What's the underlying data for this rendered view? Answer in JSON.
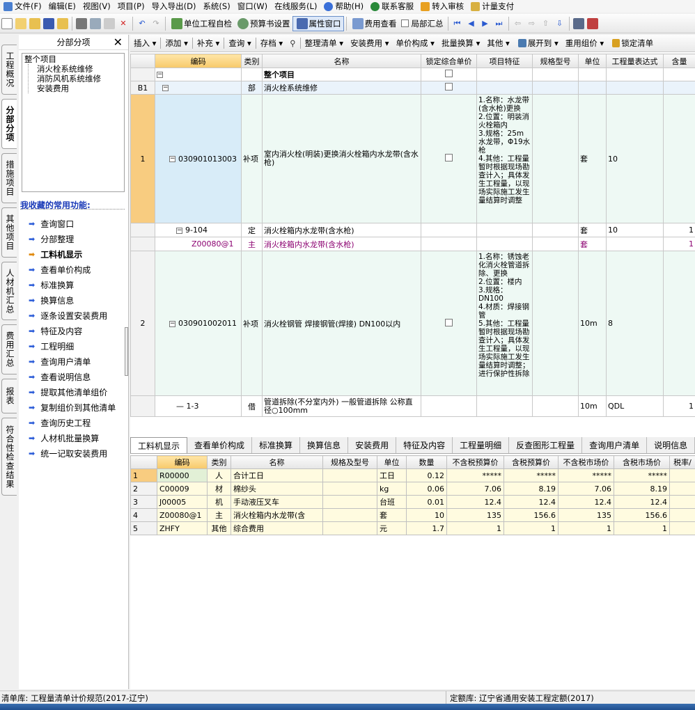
{
  "menu": [
    {
      "label": "文件(F)",
      "icon": "file-menu-icon"
    },
    {
      "label": "编辑(E)"
    },
    {
      "label": "视图(V)"
    },
    {
      "label": "项目(P)"
    },
    {
      "label": "导入导出(D)"
    },
    {
      "label": "系统(S)"
    },
    {
      "label": "窗口(W)"
    },
    {
      "label": "在线服务(L)"
    },
    {
      "label": "帮助(H)",
      "icon": "help-icon"
    },
    {
      "label": "联系客服",
      "icon": "contact-service-icon"
    },
    {
      "label": "转入审核",
      "icon": "audit-icon"
    },
    {
      "label": "计量支付",
      "icon": "payment-icon"
    }
  ],
  "toolbar": {
    "unit_check": "单位工程自检",
    "budget_settings": "预算书设置",
    "property_window": "属性窗口",
    "fee_view": "费用查看",
    "local_summary": "局部汇总"
  },
  "left_tabs": [
    "工程概况",
    "分部分项",
    "措施项目",
    "其他项目",
    "人材机汇总",
    "费用汇总",
    "报表",
    "符合性检查结果"
  ],
  "left_panel": {
    "title": "分部分项",
    "close": "✕",
    "tree": {
      "root": "整个项目",
      "children": [
        "消火栓系统维修",
        "消防风机系统维修",
        "安装费用"
      ]
    },
    "fav_title": "我收藏的常用功能:",
    "favorites": [
      "查询窗口",
      "分部整理",
      "工料机显示",
      "查看单价构成",
      "标准换算",
      "换算信息",
      "逐条设置安装费用",
      "特征及内容",
      "工程明细",
      "查询用户清单",
      "查看说明信息",
      "提取其他清单组价",
      "复制组价到其他清单",
      "查询历史工程",
      "人材机批量换算",
      "统一记取安装费用"
    ]
  },
  "grid_toolbar": [
    "插入",
    "添加",
    "补充",
    "查询",
    "存档",
    "整理清单",
    "安装费用",
    "单价构成",
    "批量换算",
    "其他",
    "展开到",
    "重用组价",
    "锁定清单"
  ],
  "grid": {
    "headers": [
      "编码",
      "类别",
      "名称",
      "锁定综合单价",
      "项目特征",
      "规格型号",
      "单位",
      "工程量表达式",
      "含量"
    ],
    "rows": [
      {
        "idx": "",
        "code": "",
        "type": "",
        "name": "整个项目",
        "feature": "",
        "unit": "",
        "expr": "",
        "qty": ""
      },
      {
        "idx": "B1",
        "code": "",
        "type": "部",
        "name": "消火栓系统维修",
        "feature": "",
        "unit": "",
        "expr": "",
        "qty": ""
      },
      {
        "idx": "1",
        "code": "030901013003",
        "type": "补项",
        "name": "室内消火栓(明装)更换消火栓箱内水龙带(含水枪)",
        "feature": "1.名称：水龙带(含水枪)更换\n2.位置：明装消火栓箱内\n3.规格：25m水龙带，Φ19水枪\n4.其他：工程量暂时根据现场勘查计入；具体发生工程量，以现场实际施工发生量结算时调整",
        "unit": "套",
        "expr": "10",
        "qty": ""
      },
      {
        "idx": "",
        "code": "9-104",
        "type": "定",
        "name": "消火栓箱内水龙带(含水枪)",
        "feature": "",
        "unit": "套",
        "expr": "10",
        "qty": "1"
      },
      {
        "idx": "",
        "code": "Z00080@1",
        "type": "主",
        "name": "消火栓箱内水龙带(含水枪)",
        "feature": "",
        "unit": "套",
        "expr": "",
        "qty": "1"
      },
      {
        "idx": "2",
        "code": "030901002011",
        "type": "补项",
        "name": "消火栓钢管 焊接钢管(焊接) DN100以内",
        "feature": "1.名称：锈蚀老化消火栓管道拆除、更换\n2.位置：楼内\n3.规格：DN100\n4.材质：焊接钢管\n5.其他：工程量暂时根据现场勘查计入；具体发生工程量，以现场实际施工发生量结算时调整；进行保护性拆除",
        "unit": "10m",
        "expr": "8",
        "qty": ""
      },
      {
        "idx": "",
        "code": "1-3",
        "type": "借",
        "name": "管道拆除(不分室内外) 一般管道拆除 公称直径○100mm",
        "feature": "",
        "unit": "10m",
        "expr": "QDL",
        "qty": "1"
      }
    ]
  },
  "bottom_tabs": [
    "工料机显示",
    "查看单价构成",
    "标准换算",
    "换算信息",
    "安装费用",
    "特征及内容",
    "工程量明细",
    "反查图形工程量",
    "查询用户清单",
    "说明信息"
  ],
  "sub": {
    "headers": [
      "编码",
      "类别",
      "名称",
      "规格及型号",
      "单位",
      "数量",
      "不含税预算价",
      "含税预算价",
      "不含税市场价",
      "含税市场价",
      "税率/"
    ],
    "rows": [
      {
        "i": "1",
        "code": "R00000",
        "type": "人",
        "name": "合计工日",
        "spec": "",
        "unit": "工日",
        "qty": "0.12",
        "p1": "*****",
        "p2": "*****",
        "p3": "*****",
        "p4": "*****"
      },
      {
        "i": "2",
        "code": "C00009",
        "type": "材",
        "name": "棉纱头",
        "spec": "",
        "unit": "kg",
        "qty": "0.06",
        "p1": "7.06",
        "p2": "8.19",
        "p3": "7.06",
        "p4": "8.19"
      },
      {
        "i": "3",
        "code": "J00005",
        "type": "机",
        "name": "手动液压叉车",
        "spec": "",
        "unit": "台班",
        "qty": "0.01",
        "p1": "12.4",
        "p2": "12.4",
        "p3": "12.4",
        "p4": "12.4"
      },
      {
        "i": "4",
        "code": "Z00080@1",
        "type": "主",
        "name": "消火栓箱内水龙带(含",
        "spec": "",
        "unit": "套",
        "qty": "10",
        "p1": "135",
        "p2": "156.6",
        "p3": "135",
        "p4": "156.6"
      },
      {
        "i": "5",
        "code": "ZHFY",
        "type": "其他",
        "name": "综合费用",
        "spec": "",
        "unit": "元",
        "qty": "1.7",
        "p1": "1",
        "p2": "1",
        "p3": "1",
        "p4": "1"
      }
    ]
  },
  "status": {
    "left": "清单库: 工程量清单计价规范(2017-辽宁)",
    "right": "定额库: 辽宁省通用安装工程定额(2017)"
  },
  "colors": {
    "highlight": "#f8cc80",
    "sub_row": "#fffbe0",
    "main_material": "#8b0070",
    "selected_code": "#d8ecf8"
  }
}
